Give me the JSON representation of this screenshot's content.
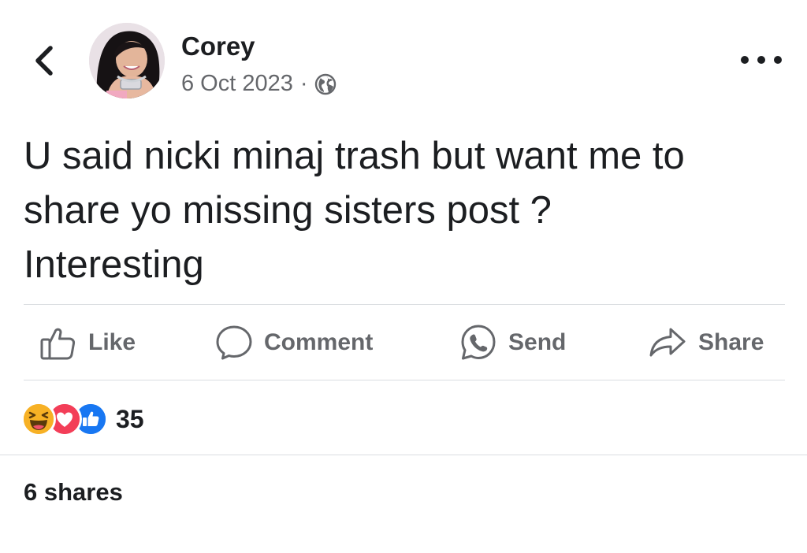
{
  "post": {
    "author": "Corey",
    "date": "6 Oct 2023",
    "separator": "·",
    "audience_icon": "globe-icon",
    "text_lines": [
      "U said nicki minaj trash but want me to",
      "share yo missing sisters post ?",
      "Interesting"
    ]
  },
  "actions": {
    "like": "Like",
    "comment": "Comment",
    "send": "Send",
    "share": "Share"
  },
  "reactions": {
    "icons": [
      "haha-icon",
      "love-icon",
      "like-icon"
    ],
    "count": "35",
    "colors": {
      "haha": "#f7b125",
      "love": "#f33e58",
      "like": "#1877f2"
    }
  },
  "shares": "6 shares",
  "colors": {
    "text": "#1c1e21",
    "secondary": "#65676b",
    "divider": "#dadde1"
  }
}
